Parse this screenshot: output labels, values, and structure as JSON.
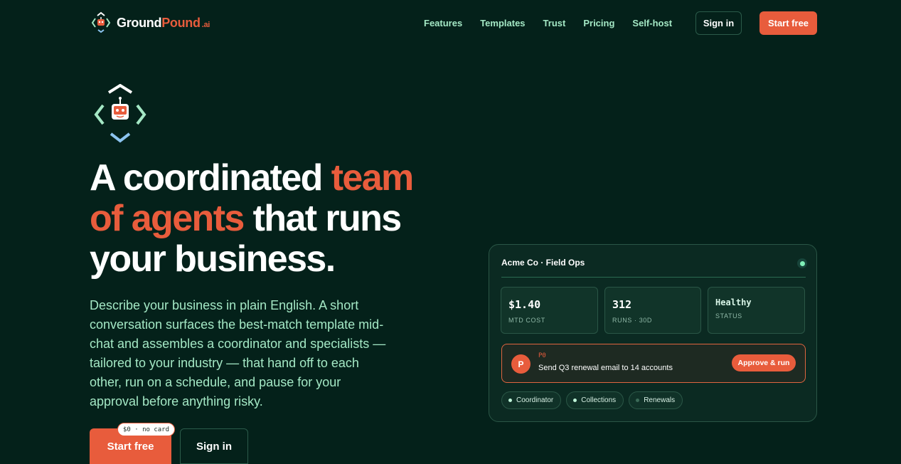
{
  "brand": {
    "name_part1": "Ground",
    "name_part2": "Pound",
    "suffix": ".ai"
  },
  "nav": {
    "links": [
      "Features",
      "Templates",
      "Trust",
      "Pricing",
      "Self-host"
    ],
    "sign_in": "Sign in",
    "start_free": "Start free"
  },
  "hero": {
    "headline_1": "A coordinated ",
    "headline_hl1": "team",
    "headline_hl2": "of agents",
    "headline_2": " that runs",
    "headline_3": "your business.",
    "description": "Describe your business in plain English. A short conversation surfaces the best-match template mid-chat and assembles a coordinator and specialists — tailored to your industry — that hand off to each other, run on a schedule, and pause for your approval before anything risky.",
    "cta_primary": "Start free",
    "cta_badge": "$0 · no card",
    "cta_secondary": "Sign in"
  },
  "dashboard": {
    "title": "Acme Co · Field Ops",
    "stats": [
      {
        "value": "$1.40",
        "label": "MTD COST"
      },
      {
        "value": "312",
        "label": "RUNS · 30D"
      },
      {
        "value": "Healthy",
        "label": "STATUS"
      }
    ],
    "approval": {
      "avatar": "P",
      "priority": "P0",
      "text": "Send Q3 renewal email to 14 accounts",
      "button": "Approve & run"
    },
    "chips": [
      "Coordinator",
      "Collections",
      "Renewals"
    ]
  },
  "colors": {
    "background": "#04211a",
    "accent": "#e85c3c",
    "mint": "#a4e8c5",
    "card": "#0b2a22"
  },
  "icons": {
    "brand_logo": "robot-in-brackets-icon",
    "status": "online-dot-icon"
  }
}
